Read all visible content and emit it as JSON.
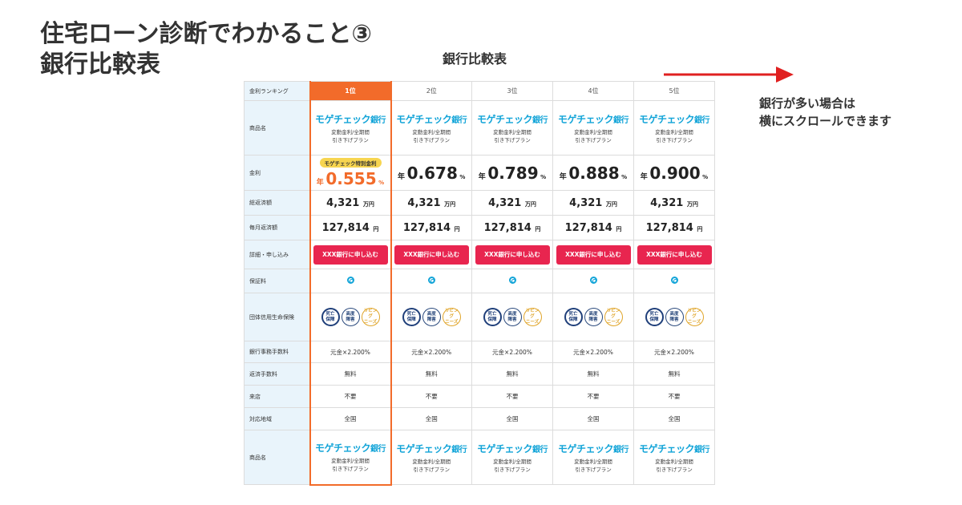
{
  "title": {
    "line1": "住宅ローン診断でわかること③",
    "line2": "銀行比較表"
  },
  "caption": "銀行比較表",
  "scroll_note": {
    "line1": "銀行が多い場合は",
    "line2": "横にスクロールできます"
  },
  "colors": {
    "accent": "#f26b2a",
    "brand": "#12a4d8",
    "button": "#e8254f",
    "arrow": "#e02020",
    "label_bg": "#e9f4fb"
  },
  "row_labels": {
    "rank": "金利ランキング",
    "product": "商品名",
    "rate": "金利",
    "total": "総返済額",
    "monthly": "毎月返済額",
    "apply": "詳細・申し込み",
    "guarantee": "保証料",
    "insurance": "団体信用生命保険",
    "fee": "銀行事務手数料",
    "prepay": "返済手数料",
    "visit": "来店",
    "area": "対応地域",
    "product2": "商品名"
  },
  "banks": [
    {
      "rank": "1位",
      "logo": "モゲチェック",
      "logo_suffix": "銀行",
      "plan1": "変動金利/全期間",
      "plan2": "引き下げプラン",
      "badge": "モゲチェック特別金利",
      "rate_prefix": "年",
      "rate": "0.555",
      "rate_unit": "%",
      "total": "4,321",
      "total_unit": "万円",
      "monthly": "127,814",
      "monthly_unit": "円",
      "button": "XXX銀行に申し込む",
      "guarantee_icon": "double-circle-icon",
      "fee": "元金×2.200%",
      "prepay": "無料",
      "visit": "不要",
      "area": "全国"
    },
    {
      "rank": "2位",
      "logo": "モゲチェック",
      "logo_suffix": "銀行",
      "plan1": "変動金利/全期間",
      "plan2": "引き下げプラン",
      "rate_prefix": "年",
      "rate": "0.678",
      "rate_unit": "%",
      "total": "4,321",
      "total_unit": "万円",
      "monthly": "127,814",
      "monthly_unit": "円",
      "button": "XXX銀行に申し込む",
      "guarantee_icon": "double-circle-icon",
      "fee": "元金×2.200%",
      "prepay": "無料",
      "visit": "不要",
      "area": "全国"
    },
    {
      "rank": "3位",
      "logo": "モゲチェック",
      "logo_suffix": "銀行",
      "plan1": "変動金利/全期間",
      "plan2": "引き下げプラン",
      "rate_prefix": "年",
      "rate": "0.789",
      "rate_unit": "%",
      "total": "4,321",
      "total_unit": "万円",
      "monthly": "127,814",
      "monthly_unit": "円",
      "button": "XXX銀行に申し込む",
      "guarantee_icon": "double-circle-icon",
      "fee": "元金×2.200%",
      "prepay": "無料",
      "visit": "不要",
      "area": "全国"
    },
    {
      "rank": "4位",
      "logo": "モゲチェック",
      "logo_suffix": "銀行",
      "plan1": "変動金利/全期間",
      "plan2": "引き下げプラン",
      "rate_prefix": "年",
      "rate": "0.888",
      "rate_unit": "%",
      "total": "4,321",
      "total_unit": "万円",
      "monthly": "127,814",
      "monthly_unit": "円",
      "button": "XXX銀行に申し込む",
      "guarantee_icon": "double-circle-icon",
      "fee": "元金×2.200%",
      "prepay": "無料",
      "visit": "不要",
      "area": "全国"
    },
    {
      "rank": "5位",
      "logo": "モゲチェック",
      "logo_suffix": "銀行",
      "plan1": "変動金利/全期間",
      "plan2": "引き下げプラン",
      "rate_prefix": "年",
      "rate": "0.900",
      "rate_unit": "%",
      "total": "4,321",
      "total_unit": "万円",
      "monthly": "127,814",
      "monthly_unit": "円",
      "button": "XXX銀行に申し込む",
      "guarantee_icon": "double-circle-icon",
      "fee": "元金×2.200%",
      "prepay": "無料",
      "visit": "不要",
      "area": "全国"
    }
  ],
  "insurance_icons": [
    {
      "name": "death-cover-icon",
      "line1": "死亡",
      "line2": "保障"
    },
    {
      "name": "disability-cover-icon",
      "line1": "高度",
      "line2": "障害"
    },
    {
      "name": "living-needs-icon",
      "line1": "リビング",
      "line2": "ニーズ"
    }
  ]
}
